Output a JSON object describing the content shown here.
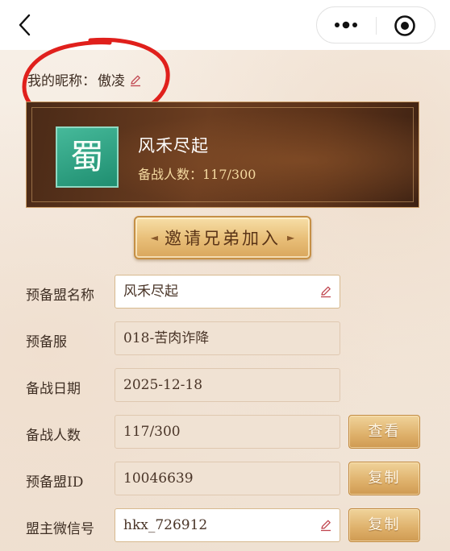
{
  "nickname": {
    "label": "我的昵称：",
    "value": "傲凌"
  },
  "banner": {
    "emblem_char": "蜀",
    "alliance_name": "风禾尽起",
    "count_label": "备战人数：117/300"
  },
  "invite_button": {
    "label": "邀请兄弟加入",
    "wing_left": "◄",
    "wing_right": "►"
  },
  "form": {
    "alliance_name": {
      "label": "预备盟名称",
      "value": "风禾尽起"
    },
    "server": {
      "label": "预备服",
      "value": "018-苦肉诈降"
    },
    "date": {
      "label": "备战日期",
      "value": "2025-12-18"
    },
    "members": {
      "label": "备战人数",
      "value": "117/300",
      "button": "查看"
    },
    "alliance_id": {
      "label": "预备盟ID",
      "value": "10046639",
      "button": "复制"
    },
    "leader_wechat": {
      "label": "盟主微信号",
      "value": "hkx_726912",
      "button": "复制"
    }
  },
  "colors": {
    "accent_gold": "#deb06a",
    "emblem_green": "#2a9e7f",
    "annotation_red": "#e0201c"
  },
  "icons": [
    "back-arrow-icon",
    "more-dots-icon",
    "target-icon",
    "pencil-edit-icon"
  ]
}
